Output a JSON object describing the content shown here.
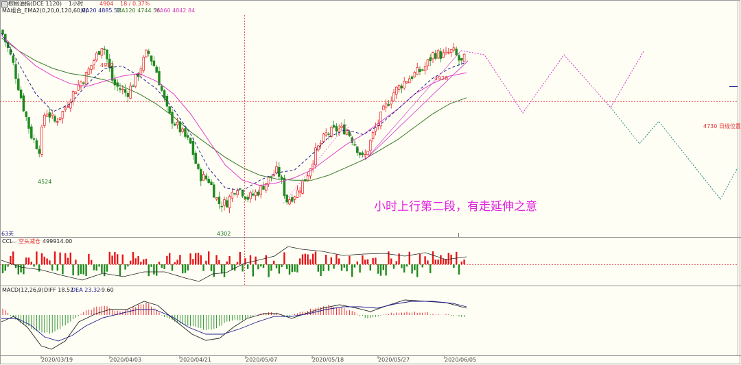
{
  "header": {
    "instrument": "棕榈油指(DCE 1120)",
    "period": "1小时",
    "last_price": "4904",
    "change": "18 / 0.37%"
  },
  "ma_legend": {
    "group": "MA组合_EMA2(0,20,0,120,60,0)",
    "ma20": "MA20 4885.52",
    "ma120": "MA120 4744.56",
    "ma60": "MA60 4842.84"
  },
  "annotations": {
    "high_1": "4982",
    "low_1": "4524",
    "low_2": "4302",
    "high_2": "4928",
    "daily_level": "4730 日线位置",
    "days": "63天",
    "comment": "小时上行第二段，有走延伸之意"
  },
  "ccl_legend": {
    "name": "CCL",
    "label": "空头减仓",
    "value": "499914.00"
  },
  "macd_legend": {
    "name": "MACD(12,26,9)",
    "diff": "DIFF 18.52",
    "dea": "DEA 23.32",
    "macd": "-9.60"
  },
  "colors": {
    "background": "#fffef4",
    "candle_up": "#e8141a",
    "candle_down": "#1f8a1f",
    "ma20": "#1d1d8c",
    "ma60": "#e040c8",
    "ma120": "#3a7a2a",
    "projection": "#cc33cc",
    "projection_down": "#2a8a8a",
    "level_line": "#e03030",
    "comment": "#e020e0"
  },
  "chart_data": {
    "type": "candlestick",
    "x_ticks": [
      "2020/03/19",
      "2020/04/03",
      "2020/04/21",
      "2020/05/07",
      "2020/05/18",
      "2020/05/27",
      "2020/06/05"
    ],
    "ylim": [
      4200,
      5070
    ],
    "series": [
      {
        "name": "MA20",
        "values": [
          5000,
          4880,
          4760,
          4690,
          4720,
          4800,
          4860,
          4870,
          4830,
          4780,
          4700,
          4600,
          4470,
          4390,
          4380,
          4420,
          4450,
          4460,
          4520,
          4590,
          4620,
          4600,
          4640,
          4700,
          4760,
          4820,
          4860,
          4885
        ]
      },
      {
        "name": "MA60",
        "values": [
          4990,
          4930,
          4870,
          4830,
          4800,
          4790,
          4810,
          4830,
          4840,
          4810,
          4760,
          4680,
          4580,
          4480,
          4420,
          4400,
          4410,
          4430,
          4460,
          4510,
          4560,
          4600,
          4650,
          4700,
          4760,
          4800,
          4830,
          4843
        ]
      },
      {
        "name": "MA120",
        "values": [
          4980,
          4930,
          4890,
          4860,
          4840,
          4830,
          4815,
          4790,
          4760,
          4720,
          4670,
          4610,
          4560,
          4510,
          4470,
          4440,
          4425,
          4420,
          4420,
          4440,
          4470,
          4500,
          4540,
          4580,
          4630,
          4680,
          4720,
          4745
        ]
      }
    ],
    "ohlc_note": "hourly candles, 2020/03/13 – 2020/06/05",
    "key_prices": {
      "high_1": 4982,
      "low_1": 4524,
      "low_2": 4302,
      "high_2": 4928,
      "daily_level": 4730
    },
    "macd": {
      "diff": 18.52,
      "dea": 23.32,
      "macd": -9.6
    },
    "ccl": {
      "value": 499914.0
    }
  }
}
